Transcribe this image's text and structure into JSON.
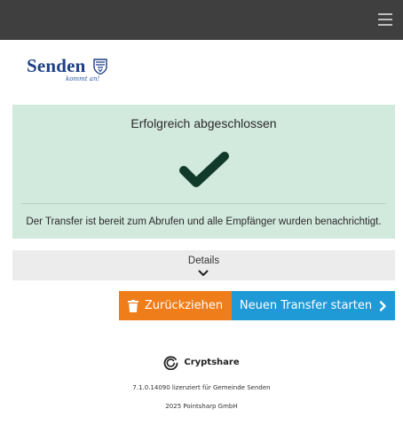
{
  "header": {
    "menu_icon": "hamburger-menu-icon"
  },
  "logo": {
    "text": "Senden",
    "tagline": "kommt an!",
    "crest_icon": "coat-of-arms-icon"
  },
  "status": {
    "title": "Erfolgreich abgeschlossen",
    "icon": "checkmark-icon",
    "message": "Der Transfer ist bereit zum Abrufen und alle Empfänger wurden benachrichtigt."
  },
  "details": {
    "label": "Details",
    "icon": "chevron-down-icon"
  },
  "actions": {
    "withdraw_label": "Zurückziehen",
    "withdraw_icon": "trash-icon",
    "new_transfer_label": "Neuen Transfer starten",
    "new_transfer_icon": "chevron-right-icon"
  },
  "footer": {
    "brand": "Cryptshare",
    "brand_icon": "cryptshare-logo-icon",
    "license": "7.1.0.14090 lizenziert für Gemeinde Senden",
    "copyright": "2025 Pointsharp GmbH"
  },
  "colors": {
    "topbar": "#3f3f3f",
    "success_bg": "#d2e9de",
    "check": "#123a2b",
    "withdraw": "#ef7d1a",
    "new_transfer": "#1f9ad7",
    "logo_blue": "#1d3f86"
  }
}
